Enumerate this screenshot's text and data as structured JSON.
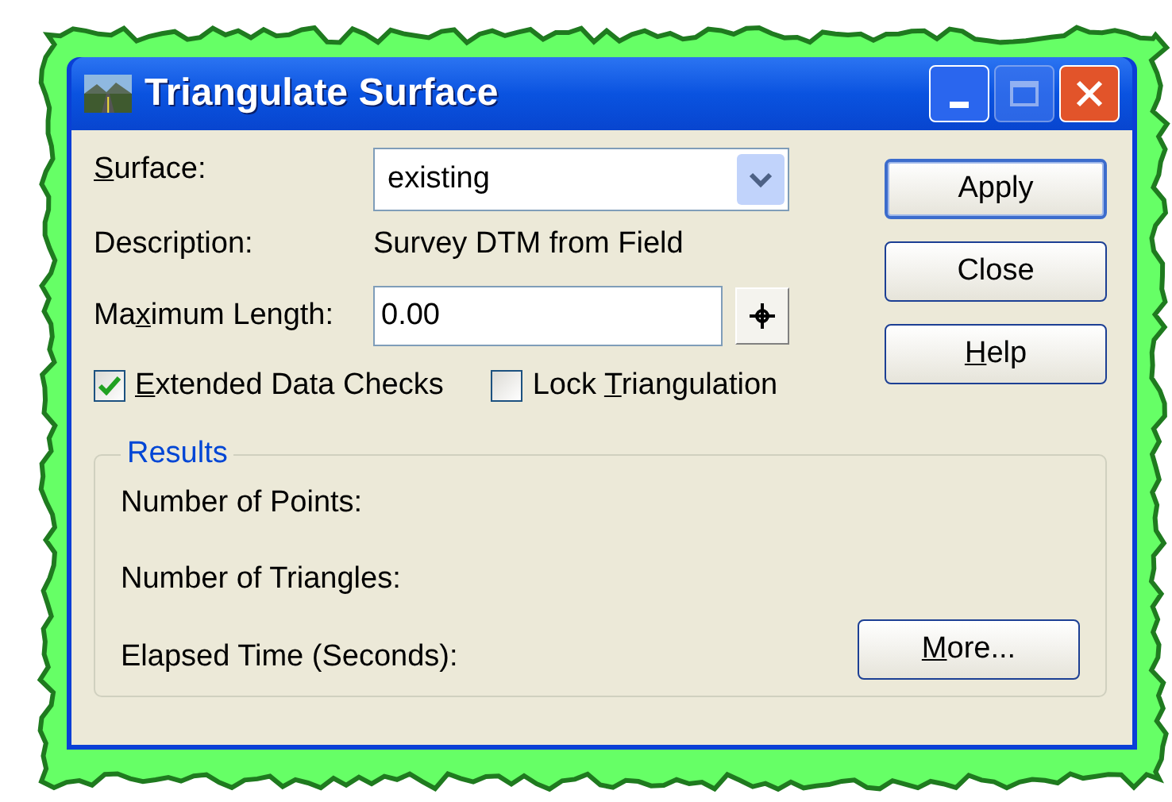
{
  "window": {
    "title": "Triangulate Surface"
  },
  "surface": {
    "label": {
      "key": "S",
      "after": "urface:"
    },
    "value": "existing"
  },
  "description": {
    "label": "Description:",
    "value": "Survey DTM from Field"
  },
  "maximum_length": {
    "label": {
      "before": "Ma",
      "key": "x",
      "after": "imum Length:"
    },
    "value": "0.00"
  },
  "checkboxes": [
    {
      "label": {
        "key": "E",
        "after": "xtended Data Checks"
      },
      "checked": true
    },
    {
      "label": {
        "before": "Lock ",
        "key": "T",
        "after": "riangulation"
      },
      "checked": false
    }
  ],
  "buttons": [
    {
      "label": {
        "before": "Apply"
      },
      "default": true
    },
    {
      "label": {
        "before": "Close"
      },
      "default": false
    },
    {
      "label": {
        "key": "H",
        "after": "elp"
      },
      "default": false
    }
  ],
  "results": {
    "title": "Results",
    "rows": [
      "Number of Points:",
      "Number of Triangles:",
      "Elapsed Time (Seconds):"
    ],
    "more_button": {
      "key": "M",
      "after": "ore..."
    }
  }
}
